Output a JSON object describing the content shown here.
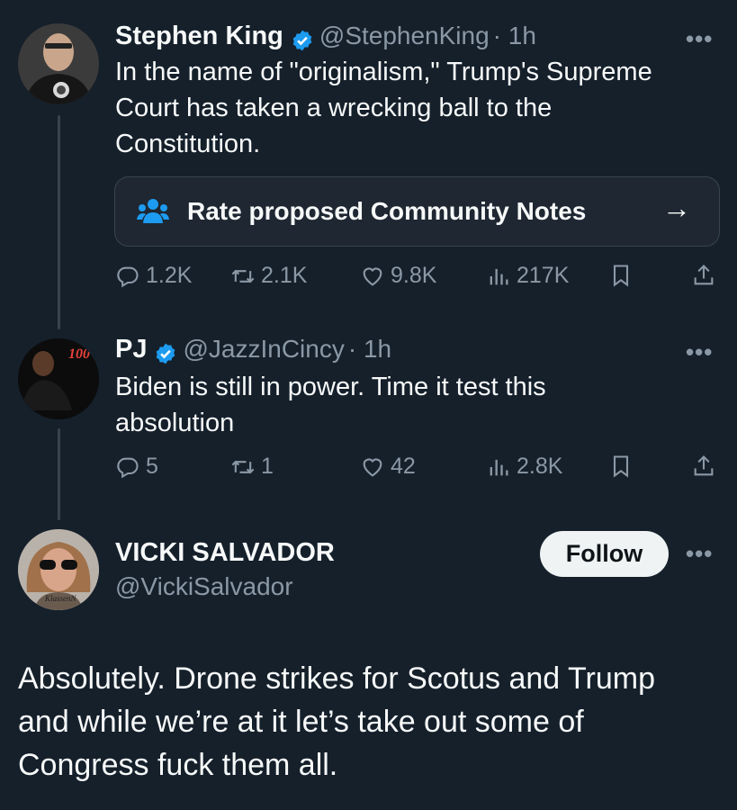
{
  "tweets": [
    {
      "name": "Stephen King",
      "handle": "@StephenKing",
      "time": "· 1h",
      "text_lines": [
        "In the name of \"originalism,\" Trump's Supreme",
        "Court has taken a wrecking ball to the",
        "Constitution."
      ],
      "replies": "1.2K",
      "retweets": "2.1K",
      "likes": "9.8K",
      "views": "217K"
    },
    {
      "name": "PJ",
      "handle": "@JazzInCincy",
      "time": "· 1h",
      "text_lines": [
        "Biden is still in power. Time it test this",
        "absolution"
      ],
      "replies": "5",
      "retweets": "1",
      "likes": "42",
      "views": "2.8K",
      "avatar_badge": "100"
    }
  ],
  "community_notes": {
    "label": "Rate proposed Community Notes",
    "arrow": "→"
  },
  "main_tweet": {
    "name": "VICKI SALVADOR",
    "handle": "@VickiSalvador",
    "follow_label": "Follow",
    "text_lines": [
      "Absolutely. Drone strikes for Scotus and Trump",
      "and while we’re at it let’s take out some of",
      "Congress fuck them all."
    ],
    "avatar_signature": "KlassenN"
  },
  "more_label": "•••",
  "colors": {
    "background": "#15202b",
    "verified": "#1d9bf0",
    "muted": "#8b98a5",
    "text": "#f7f9f9"
  }
}
